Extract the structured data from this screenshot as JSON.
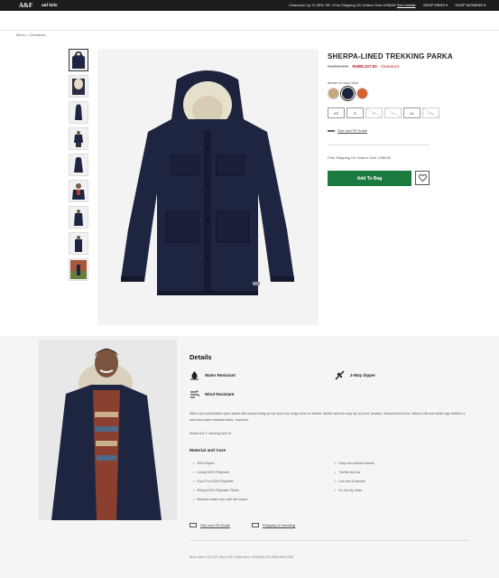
{
  "topbar": {
    "logo": "A&F",
    "brand_kids": "a&f kids",
    "promo_text": "Clearance Up To 50% Off • Free Shipping On Orders Over US$150",
    "promo_link": "See Details",
    "nav": [
      "SHOP MENS ▾",
      "SHOP WOMENS ▾"
    ]
  },
  "breadcrumb": "Mens  >  Clearance",
  "gallery": {
    "thumbnail_count": 9,
    "active_index": 0
  },
  "product": {
    "title": "SHERPA-LINED TREKKING PARKA",
    "old_price": "RUB16,825",
    "new_price": "RUB9,327.50",
    "price_tag": "Clearance",
    "color_label": "shown in navy blue",
    "swatches": [
      {
        "name": "tan",
        "color": "#c8a97a"
      },
      {
        "name": "navy blue",
        "color": "#1b2240",
        "selected": true
      },
      {
        "name": "orange",
        "color": "#d4622e"
      }
    ],
    "sizes": [
      {
        "label": "XS",
        "available": true
      },
      {
        "label": "S",
        "available": true
      },
      {
        "label": "M",
        "available": false
      },
      {
        "label": "L",
        "available": false
      },
      {
        "label": "XL",
        "available": true
      },
      {
        "label": "XXL",
        "available": false
      }
    ],
    "size_guide_link": "Size and Fit Guide",
    "shipping_note": "Free Shipping On Orders Over US$150",
    "add_to_bag_label": "Add To Bag",
    "wishlist_icon": "heart-icon"
  },
  "details": {
    "title": "Details",
    "features": [
      {
        "label": "Water Resistant",
        "icon": "water-drop-icon"
      },
      {
        "label": "2-Way Zipper",
        "icon": "zipper-icon"
      },
      {
        "label": "Wind Resistant",
        "icon": "wind-icon"
      }
    ],
    "description": "Warm and comfortable nylon parka with sherpa lining up top and cozy cargo point on leather. Button and two-way zip up front, pockets, sherpa-lined hood, ribbed cuffs and detail logo detail in a wind and water-resistant fabric. Imported.",
    "model_note": "Model is 6'1\" wearing Size M",
    "material_care_title": "Material and Care",
    "care_left": [
      "100% Nylon",
      "Lining:100% Polyester",
      "Faux Fur:100% Polyester",
      "Filling:100% Polyester Fibres",
      "Machine wash cold, with like colors"
    ],
    "care_right": [
      "Only non-chlorine bleach",
      "Tumble dry low",
      "Low iron if needed",
      "Do not dry clean"
    ],
    "bottom_links": [
      "Size and Fit Guide",
      "Shipping & Handling"
    ],
    "item_numbers": "Store Item: 132-327-0612-200  |  Web Item: 2199331(132-9500-0612-200"
  }
}
